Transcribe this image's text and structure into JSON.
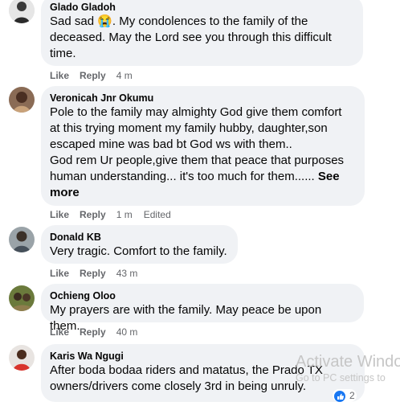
{
  "comments": [
    {
      "author": "Glado Gladoh",
      "lines": [
        "Sad sad 😭. My condolences to the family of the",
        "deceased. May the Lord see you through this difficult",
        "time."
      ],
      "like": "Like",
      "reply": "Reply",
      "time": "4 m"
    },
    {
      "author": "Veronicah Jnr Okumu",
      "lines": [
        "Pole to the family may almighty God give them comfort",
        "at this trying moment my family hubby, daughter,son",
        "escaped mine was bad bt God ws with them..",
        "God rem Ur people,give them that peace that purposes",
        "human understanding... it's too much for them......"
      ],
      "see_more_inline": "See",
      "see_more_next": "more",
      "like": "Like",
      "reply": "Reply",
      "time": "1 m",
      "edited": "Edited"
    },
    {
      "author": "Donald KB",
      "lines": [
        "Very tragic. Comfort to the family."
      ],
      "like": "Like",
      "reply": "Reply",
      "time": "43 m"
    },
    {
      "author": "Ochieng Oloo",
      "lines": [
        "My prayers are with the family. May peace be upon them."
      ],
      "like": "Like",
      "reply": "Reply",
      "time": "40 m"
    },
    {
      "author": "Karis Wa Ngugi",
      "lines": [
        "After boda bodaa riders and matatus, the Prado TX",
        "owners/drivers come closely 3rd in being unruly."
      ]
    }
  ],
  "watermark": {
    "title": "Activate Windo",
    "subtitle": "Go to PC settings to"
  },
  "reaction_count": "2",
  "colors": {
    "bubble": "#f0f2f5",
    "meta": "#65676b",
    "text": "#050505"
  }
}
